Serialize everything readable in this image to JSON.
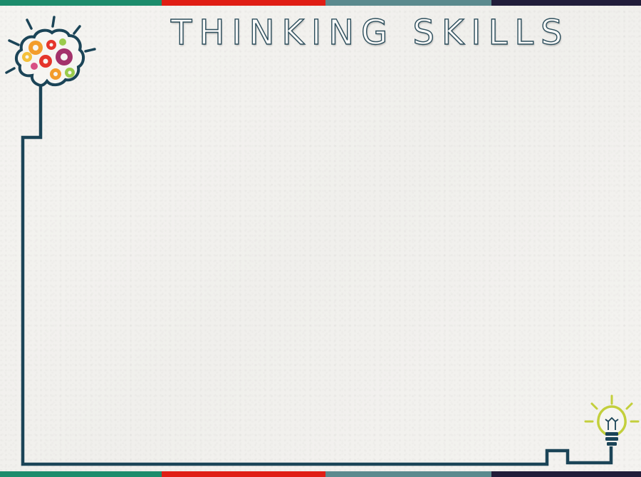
{
  "slide": {
    "title": "THINKING SKILLS"
  },
  "colors": {
    "stripe": [
      "#1d8c6c",
      "#e01e15",
      "#5b8a8e",
      "#211d3a"
    ],
    "line": "#1b4457",
    "bulb": "#c3cf3c",
    "gears": [
      "#f39c2b",
      "#e5352b",
      "#a3326b",
      "#f4c03a",
      "#9acb4c",
      "#d84f84"
    ]
  },
  "icons": {
    "top_left": "brain-gears-icon",
    "bottom_right": "lightbulb-icon"
  }
}
